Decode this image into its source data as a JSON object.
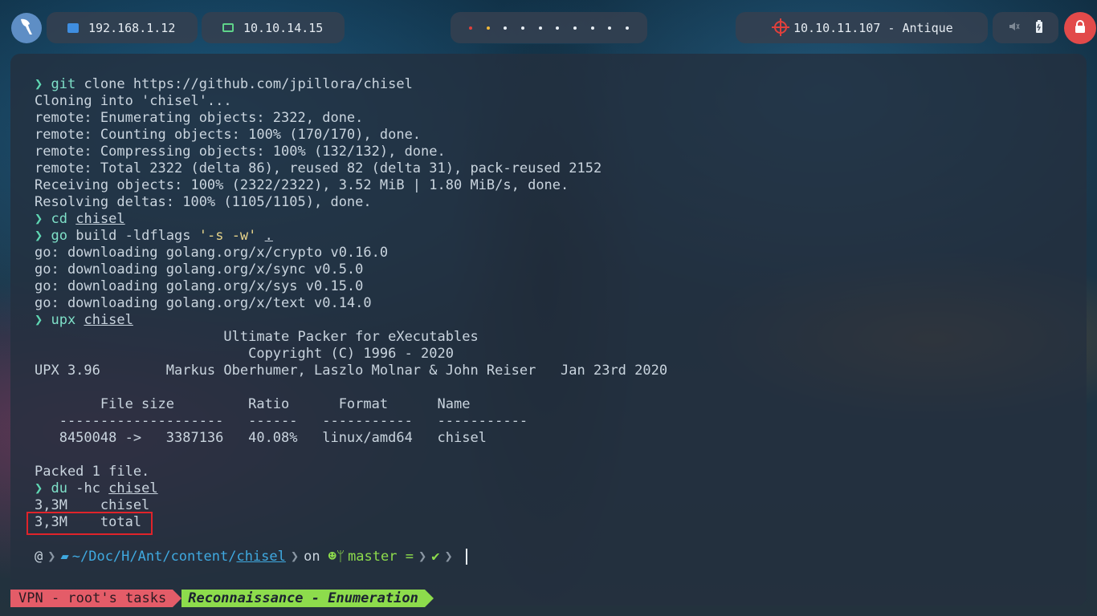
{
  "topbar": {
    "logo_icon": "crane-bird-icon",
    "ethernet_ip": "192.168.1.12",
    "vpn_ip": "10.10.14.15",
    "workspaces": [
      "•",
      "•",
      "•",
      "•",
      "•",
      "•",
      "•",
      "•",
      "•",
      "•"
    ],
    "workspace_colors": [
      "#e0403c",
      "#f0b83a",
      "#e8eef4",
      "#e8eef4",
      "#e8eef4",
      "#e8eef4",
      "#e8eef4",
      "#e8eef4",
      "#e8eef4",
      "#e8eef4"
    ],
    "target_label": "10.10.11.107 - Antique",
    "mute_icon": "muted-speaker-icon",
    "battery_icon": "battery-icon",
    "lock_icon": "lock-icon"
  },
  "terminal": {
    "lines": [
      {
        "prompt": "❯",
        "cmd": "git",
        "rest": " clone https://github.com/jpillora/chisel"
      },
      {
        "text": "Cloning into 'chisel'..."
      },
      {
        "text": "remote: Enumerating objects: 2322, done."
      },
      {
        "text": "remote: Counting objects: 100% (170/170), done."
      },
      {
        "text": "remote: Compressing objects: 100% (132/132), done."
      },
      {
        "text": "remote: Total 2322 (delta 86), reused 82 (delta 31), pack-reused 2152"
      },
      {
        "text": "Receiving objects: 100% (2322/2322), 3.52 MiB | 1.80 MiB/s, done."
      },
      {
        "text": "Resolving deltas: 100% (1105/1105), done."
      },
      {
        "prompt": "❯",
        "cmd": "cd",
        "arg": "chisel"
      },
      {
        "prompt": "❯",
        "cmd": "go",
        "rest": " build -ldflags ",
        "str": "'-s -w'",
        "arg": "."
      },
      {
        "text": "go: downloading golang.org/x/crypto v0.16.0"
      },
      {
        "text": "go: downloading golang.org/x/sync v0.5.0"
      },
      {
        "text": "go: downloading golang.org/x/sys v0.15.0"
      },
      {
        "text": "go: downloading golang.org/x/text v0.14.0"
      },
      {
        "prompt": "❯",
        "cmd": "upx",
        "arg": "chisel"
      },
      {
        "text": "                       Ultimate Packer for eXecutables"
      },
      {
        "text": "                          Copyright (C) 1996 - 2020"
      },
      {
        "text": "UPX 3.96        Markus Oberhumer, Laszlo Molnar & John Reiser   Jan 23rd 2020"
      },
      {
        "text": ""
      },
      {
        "text": "        File size         Ratio      Format      Name"
      },
      {
        "text": "   --------------------   ------   -----------   -----------"
      },
      {
        "text": "   8450048 ->   3387136   40.08%   linux/amd64   chisel"
      },
      {
        "text": ""
      },
      {
        "text": "Packed 1 file."
      },
      {
        "prompt": "❯",
        "cmd": "du",
        "rest": " -hc ",
        "arg": "chisel"
      },
      {
        "text": "3,3M    chisel"
      },
      {
        "text": "3,3M    total"
      }
    ],
    "powerline": {
      "os_icon": "debian-swirl-icon",
      "folder_icon": "folder-icon",
      "path_prefix": "~/Doc/H/Ant/content/",
      "path_current": "chisel",
      "on_label": "on",
      "git_icon": "github-octocat-icon",
      "branch_icon": "git-branch-icon",
      "branch": "master =",
      "check": "✔"
    }
  },
  "taskbar": {
    "vpn_task": "VPN - root's tasks",
    "active_task": "Reconnaissance - Enumeration"
  }
}
